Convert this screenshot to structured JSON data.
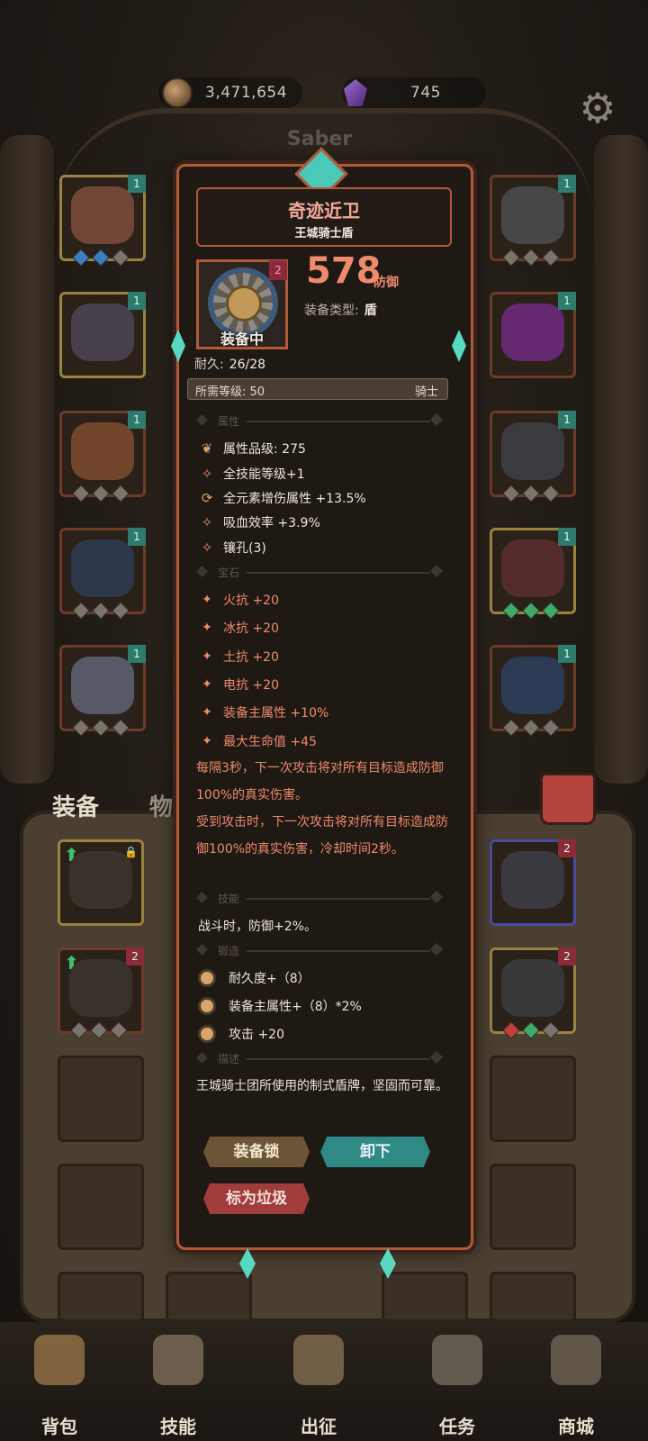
{
  "currency": {
    "coins": "3,471,654",
    "gems": "745"
  },
  "hero": {
    "name": "Saber"
  },
  "left_slots": [
    {
      "level": "1"
    },
    {
      "level": "1"
    },
    {
      "level": "1"
    },
    {
      "level": "1"
    },
    {
      "level": "1"
    }
  ],
  "right_slots": [
    {
      "level": "1"
    },
    {
      "level": "1"
    },
    {
      "level": "1"
    },
    {
      "level": "1"
    },
    {
      "level": "1"
    }
  ],
  "tabs": {
    "equipment": "装备",
    "items": "物品"
  },
  "bag": {
    "row1": [
      {
        "lock": "🔒"
      },
      {
        "level": "2"
      }
    ],
    "row2": [
      {
        "level": "2"
      },
      {
        "level": "2"
      }
    ]
  },
  "item": {
    "name": "奇迹近卫",
    "subtitle": "王城骑士盾",
    "icon_badge": "2",
    "equipped_label": "装备中",
    "stat_value": "578",
    "stat_unit": "防御",
    "type_label": "装备类型:",
    "type_value": "盾",
    "durability_label": "耐久:",
    "durability_value": "26/28",
    "req_level_label": "所需等级: 50",
    "req_class": "骑士"
  },
  "sections": {
    "attributes": "属性",
    "gems": "宝石",
    "skills": "技能",
    "forge": "锻造",
    "description": "描述"
  },
  "attributes": [
    {
      "icon": "quality-icon",
      "text": "属性品级: 275"
    },
    {
      "icon": "skill-level-icon",
      "text": "全技能等级+1"
    },
    {
      "icon": "element-cycle-icon",
      "text": "全元素增伤属性 +13.5%"
    },
    {
      "icon": "lifesteal-icon",
      "text": "吸血效率 +3.9%"
    },
    {
      "icon": "socket-icon",
      "text": "镶孔(3)"
    }
  ],
  "gem_stats": [
    "火抗 +20",
    "冰抗 +20",
    "土抗 +20",
    "电抗 +20",
    "装备主属性 +10%",
    "最大生命值 +45"
  ],
  "effects": [
    "每隔3秒，下一次攻击将对所有目标造成防御100%的真实伤害。",
    "受到攻击时，下一次攻击将对所有目标造成防御100%的真实伤害，冷却时间2秒。"
  ],
  "skill_text": "战斗时，防御+2%。",
  "forge": [
    "耐久度+（8）",
    "装备主属性+（8）*2%",
    "攻击 +20"
  ],
  "description": "王城骑士团所使用的制式盾牌，坚固而可靠。",
  "buttons": {
    "lock": "装备锁",
    "unequip": "卸下",
    "junk": "标为垃圾"
  },
  "nav": [
    {
      "label": "背包",
      "icon": "backpack-icon"
    },
    {
      "label": "技能",
      "icon": "skill-book-icon"
    },
    {
      "label": "出征",
      "icon": "battle-icon"
    },
    {
      "label": "任务",
      "icon": "quest-icon"
    },
    {
      "label": "商城",
      "icon": "shop-icon"
    }
  ],
  "colors": {
    "accent": "#f08a6d",
    "frame": "#b05a3a",
    "teal": "#2f8a86"
  }
}
